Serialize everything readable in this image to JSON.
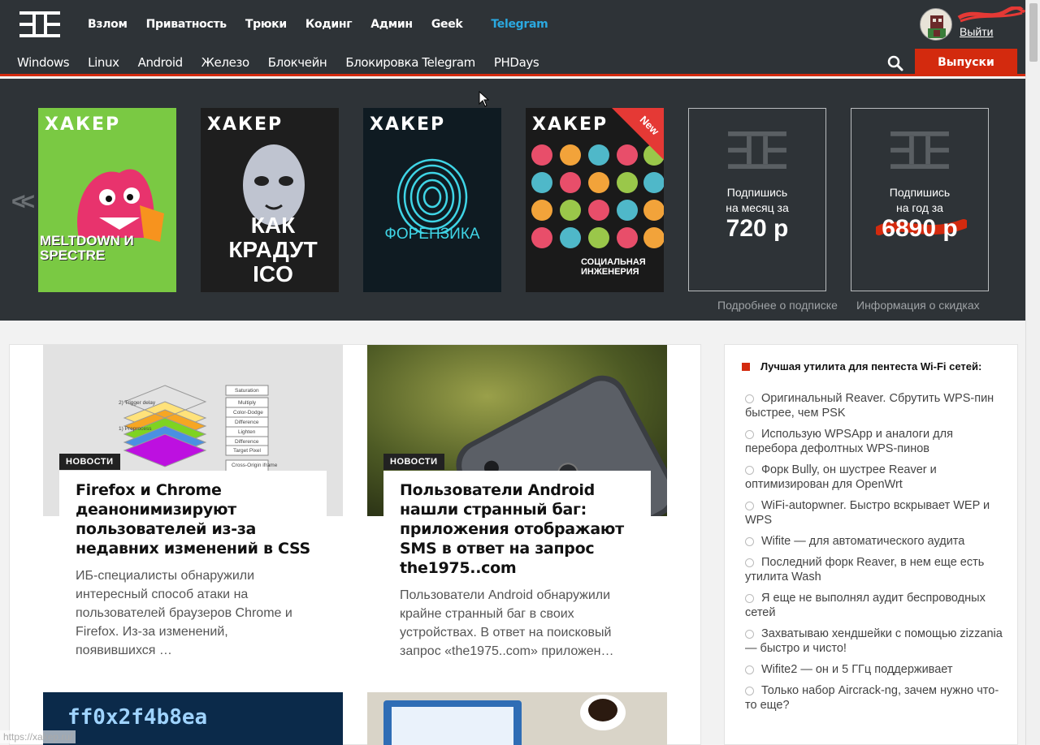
{
  "top_nav": [
    "Взлом",
    "Приватность",
    "Трюки",
    "Кодинг",
    "Админ",
    "Geek"
  ],
  "telegram_label": "Telegram",
  "logout_label": "Выйти",
  "sub_nav": [
    "Windows",
    "Linux",
    "Android",
    "Железо",
    "Блокчейн",
    "Блокировка Telegram",
    "PHDays"
  ],
  "issues_label": "Выпуски",
  "covers": [
    {
      "mast": "ХАКЕР",
      "headline": "MELTDOWN И SPECTRE",
      "bg": "#7ac943"
    },
    {
      "mast": "ХАКЕР",
      "headline": "КАК КРАДУТ ICO",
      "bg": "#1e1e1e"
    },
    {
      "mast": "ХАКЕР",
      "headline": "ФОРЕНЗИКА",
      "bg": "#0f1b22"
    },
    {
      "mast": "ХАКЕР",
      "headline": "СОЦИАЛЬНАЯ ИНЖЕНЕРИЯ",
      "bg": "#1a1a1a",
      "badge": "New"
    }
  ],
  "subscribe_month": {
    "line1": "Подпишись",
    "line2": "на месяц за",
    "price": "720 р"
  },
  "subscribe_year": {
    "line1": "Подпишись",
    "line2": "на год за",
    "price": "6890 р"
  },
  "sub_links": [
    "Подробнее о подписке",
    "Информация о скидках"
  ],
  "articles": [
    {
      "tag": "НОВОСТИ",
      "title": "Firefox и Chrome деанонимизируют пользователей из-за недавних изменений в CSS",
      "excerpt": "ИБ-специалисты обнаружили интересный способ атаки на пользователей браузеров Chrome и Firefox. Из-за изменений, появившихся …"
    },
    {
      "tag": "НОВОСТИ",
      "title": "Пользователи Android нашли странный баг: приложения отображают SMS в ответ на запрос the1975..com",
      "excerpt": "Пользователи Android обнаружили крайне странный баг в своих устройствах. В ответ на поисковый запрос «the1975..com» приложен…"
    }
  ],
  "diagram_labels": [
    "Saturation",
    "Multiply",
    "Color-Dodge",
    "Difference",
    "Lighten",
    "Difference",
    "Target Pixel",
    "Cross-Origin iframe",
    "2) Trigger delay",
    "1) Preprocess"
  ],
  "poll": {
    "title": "Лучшая утилита для пентеста Wi-Fi сетей:",
    "options": [
      "Оригинальный Reaver. Сбрутить WPS-пин быстрее, чем PSK",
      "Использую WPSApp и аналоги для перебора дефолтных WPS-пинов",
      "Форк Bully, он шустрее Reaver и оптимизирован для OpenWrt",
      "WiFi-autopwner. Быстро вскрывает WEP и WPS",
      "Wifite — для автоматического аудита",
      "Последний форк Reaver, в нем еще есть утилита Wash",
      "Я еще не выполнял аудит беспроводных сетей",
      "Захватываю хендшейки с помощью zizzania — быстро и чисто!",
      "Wifite2 — он и 5 ГГц поддерживает",
      "Только набор Aircrack-ng, зачем нужно что-то еще?"
    ]
  },
  "bottom_image_text": "ff0x2f4b8ea",
  "status_url": "https://xakep.ru/",
  "colors": {
    "accent": "#d32a0e",
    "dark": "#2e3337",
    "telegram": "#2ba9e0"
  }
}
